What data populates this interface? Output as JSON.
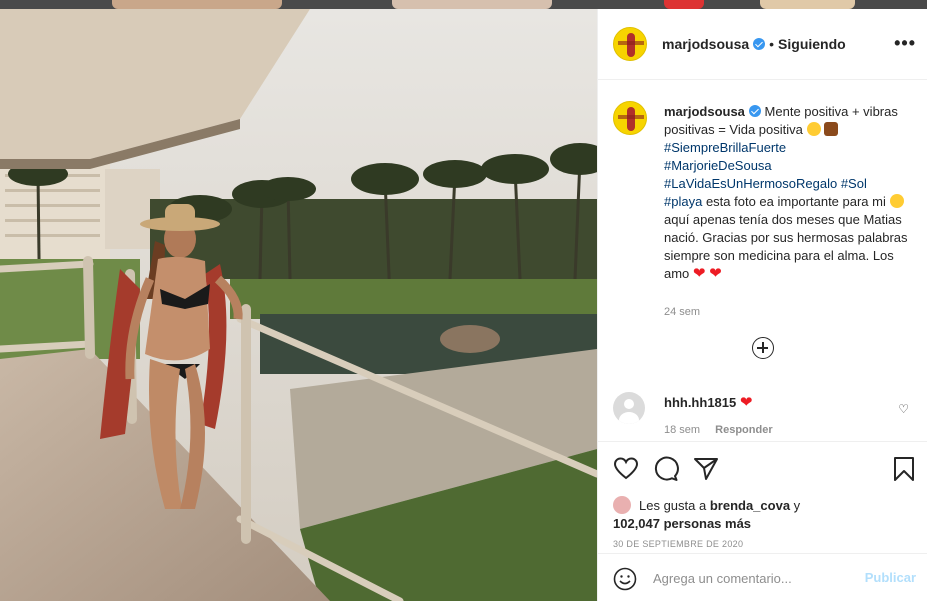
{
  "post": {
    "username": "marjodsousa",
    "follow_status": "Siguiendo",
    "more_label": "•••",
    "separator": "•"
  },
  "caption": {
    "username": "marjodsousa",
    "line1": "Mente positiva + vibras positivas = Vida positiva",
    "tags1": [
      "#SiempreBrillaFuerte",
      "#MarjorieDeSousa",
      "#LaVidaEsUnHermosoRegalo",
      "#Sol",
      "#playa"
    ],
    "body": "esta foto ea importante para mi",
    "body2": "aquí apenas tenía dos meses que Matias nació. Gracias por sus hermosas palabras siempre son medicina para el alma. Los amo",
    "time": "24 sem"
  },
  "comment": {
    "username": "hhh.hh1815",
    "heart": "❤",
    "time": "18 sem",
    "reply_label": "Responder"
  },
  "likes": {
    "prefix": "Les gusta a",
    "user": "brenda_cova",
    "joiner": "y",
    "count": "102,047 personas más"
  },
  "date": "30 DE SEPTIEMBRE DE 2020",
  "comment_box": {
    "placeholder": "Agrega un comentario...",
    "post_label": "Publicar"
  },
  "icons": {
    "more": "more-options-icon",
    "verified": "verified-badge-icon",
    "add": "load-more-comments-icon",
    "like": "heart-icon",
    "comment": "comment-icon",
    "share": "share-icon",
    "save": "bookmark-icon",
    "emoji": "emoji-icon"
  },
  "colors": {
    "link": "#00376b",
    "verified": "#3897f0",
    "heart": "#ed1c24",
    "post_disabled": "#b2dffc",
    "muted": "#8e8e8e"
  }
}
